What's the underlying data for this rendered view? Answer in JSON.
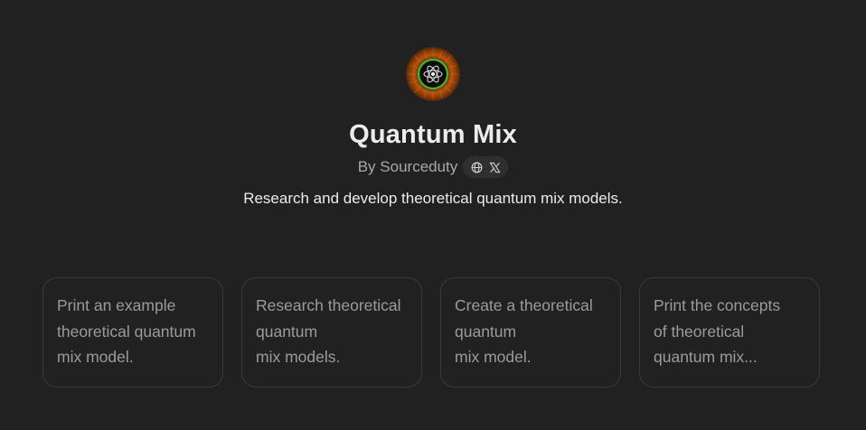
{
  "gpt": {
    "logo_icon": "atom-icon",
    "name": "Quantum Mix",
    "author": "By Sourceduty",
    "description": "Research and develop theoretical quantum mix models."
  },
  "social": {
    "web_icon": "globe-icon",
    "x_icon": "x-logo-icon"
  },
  "starters": [
    {
      "text": "Print an example\ntheoretical quantum\nmix model."
    },
    {
      "text": "Research theoretical\nquantum\nmix models."
    },
    {
      "text": "Create a theoretical\nquantum\nmix model."
    },
    {
      "text": "Print the concepts\nof theoretical\nquantum mix..."
    }
  ],
  "colors": {
    "background": "#212121",
    "card_border": "#3a3a3a",
    "text_primary": "#ececec",
    "text_muted": "#9b9b9b"
  }
}
